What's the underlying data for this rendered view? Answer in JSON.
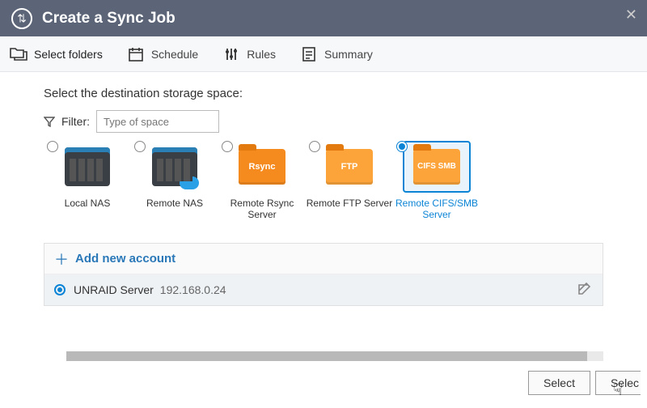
{
  "window": {
    "title": "Create a Sync Job"
  },
  "steps": {
    "select_folders": "Select folders",
    "schedule": "Schedule",
    "rules": "Rules",
    "summary": "Summary"
  },
  "instruction": "Select the destination storage space:",
  "filter": {
    "label": "Filter:",
    "placeholder": "Type of space"
  },
  "spaces": {
    "local_nas": "Local NAS",
    "remote_nas": "Remote NAS",
    "remote_rsync": "Remote Rsync Server",
    "remote_ftp": "Remote FTP Server",
    "remote_cifs": "Remote CIFS/SMB Server",
    "rsync_tag": "Rsync",
    "ftp_tag": "FTP",
    "cifs_tag": "CIFS SMB",
    "selected": "remote_cifs"
  },
  "accounts": {
    "add_label": "Add new account",
    "items": [
      {
        "name": "UNRAID Server",
        "ip": "192.168.0.24",
        "selected": true
      }
    ]
  },
  "footer": {
    "select_btn": "Select",
    "select_btn2": "Selec"
  }
}
